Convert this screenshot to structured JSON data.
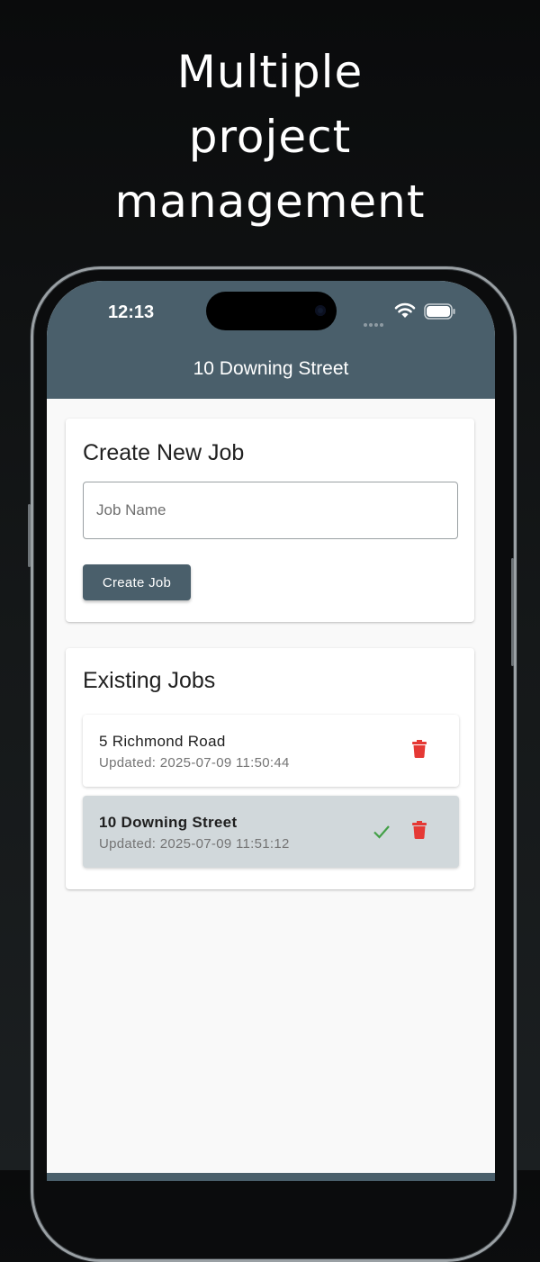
{
  "promo": {
    "line1": "Multiple",
    "line2": "project",
    "line3": "management"
  },
  "status_bar": {
    "time": "12:13"
  },
  "app_bar": {
    "title": "10 Downing Street"
  },
  "create_card": {
    "title": "Create New Job",
    "input_placeholder": "Job Name",
    "input_value": "",
    "button_label": "Create Job"
  },
  "existing_card": {
    "title": "Existing Jobs",
    "jobs": [
      {
        "name": "5 Richmond Road",
        "updated": "Updated: 2025-07-09 11:50:44",
        "selected": false
      },
      {
        "name": "10 Downing Street",
        "updated": "Updated: 2025-07-09 11:51:12",
        "selected": true
      }
    ]
  },
  "colors": {
    "app_bar": "#4a5f6b",
    "selected_row": "#d1d8db",
    "delete": "#e53935",
    "check": "#43a047"
  },
  "icons": [
    "wifi-icon",
    "battery-icon",
    "trash-icon",
    "check-icon"
  ]
}
